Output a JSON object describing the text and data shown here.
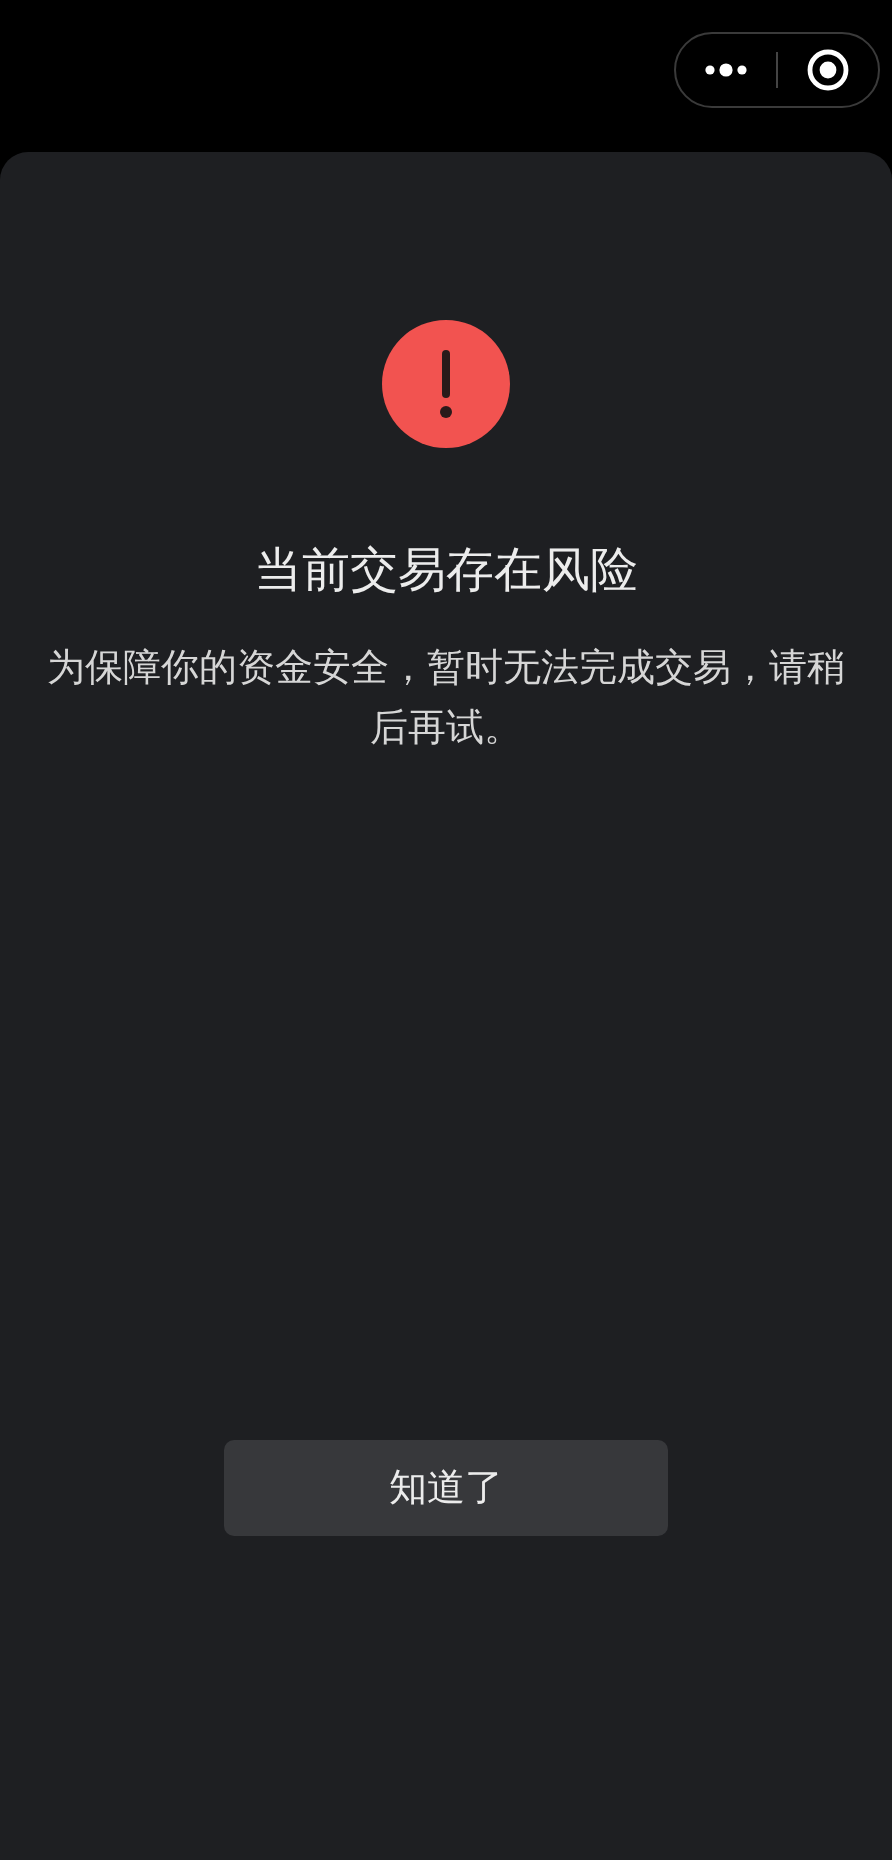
{
  "dialog": {
    "title": "当前交易存在风险",
    "message": "为保障你的资金安全，暂时无法完成交易，请稍后再试。",
    "button": "知道了"
  }
}
